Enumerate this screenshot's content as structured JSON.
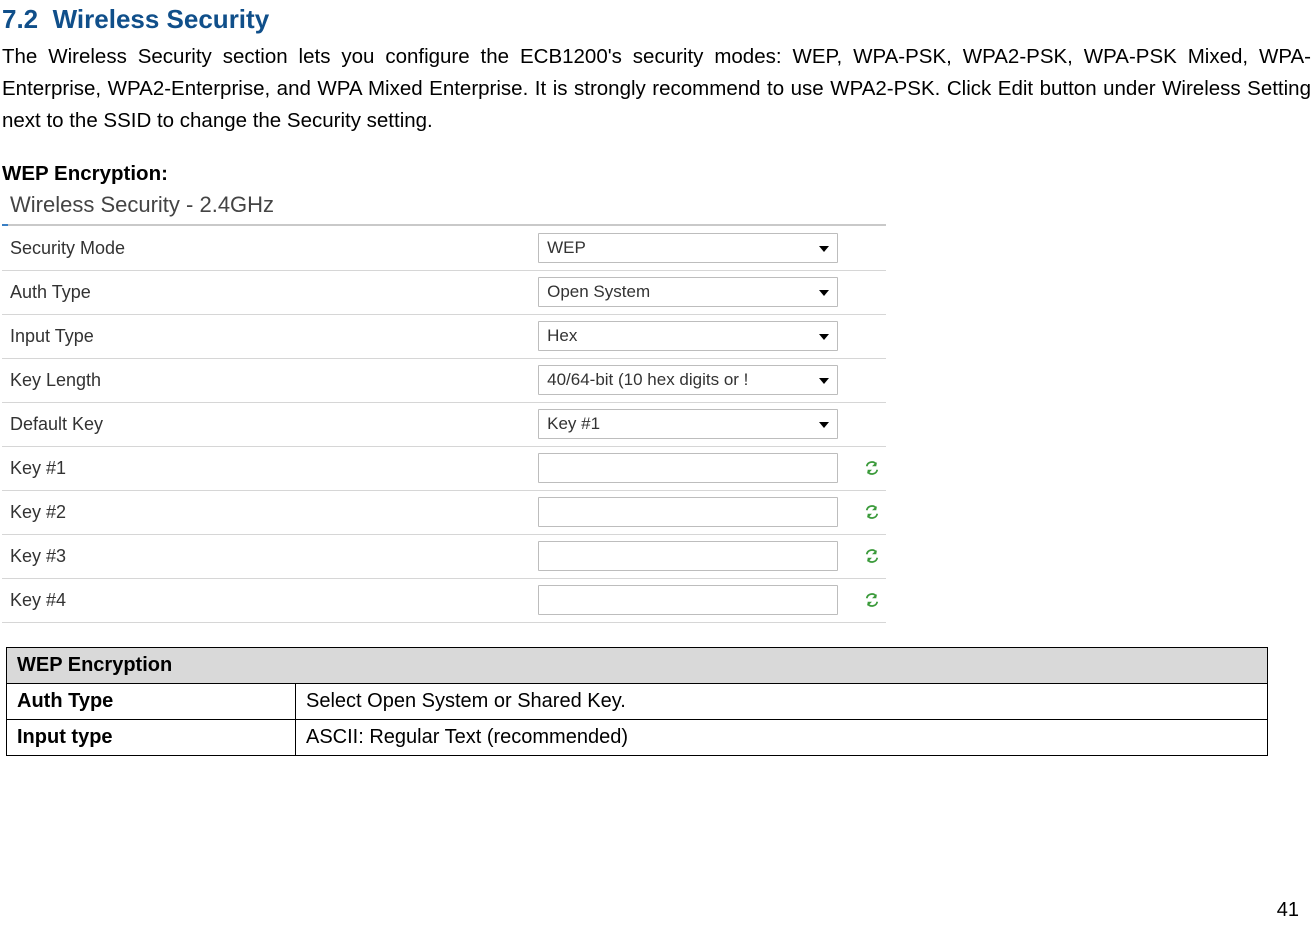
{
  "section": {
    "number": "7.2",
    "title": "Wireless Security"
  },
  "paragraph": "The Wireless Security section lets you configure the ECB1200's security modes: WEP, WPA-PSK, WPA2-PSK, WPA-PSK Mixed, WPA-Enterprise, WPA2-Enterprise, and WPA Mixed Enterprise. It is strongly recommend to use WPA2-PSK. Click Edit button under Wireless Setting next to the SSID to change the Security setting.",
  "subhead": "WEP Encryption:",
  "screenshot": {
    "heading": "Wireless Security - 2.4GHz",
    "rows": {
      "security_mode": {
        "label": "Security Mode",
        "value": "WEP"
      },
      "auth_type": {
        "label": "Auth Type",
        "value": "Open System"
      },
      "input_type": {
        "label": "Input Type",
        "value": "Hex"
      },
      "key_length": {
        "label": "Key Length",
        "value": "40/64-bit (10 hex digits or !"
      },
      "default_key": {
        "label": "Default Key",
        "value": "Key #1"
      },
      "key1": {
        "label": "Key #1",
        "value": ""
      },
      "key2": {
        "label": "Key #2",
        "value": ""
      },
      "key3": {
        "label": "Key #3",
        "value": ""
      },
      "key4": {
        "label": "Key #4",
        "value": ""
      }
    }
  },
  "doctable": {
    "header": "WEP Encryption",
    "rows": [
      {
        "name": "Auth Type",
        "desc": "Select Open System or Shared Key."
      },
      {
        "name": "Input type",
        "desc": "ASCII: Regular Text (recommended)"
      }
    ]
  },
  "page_number": "41"
}
